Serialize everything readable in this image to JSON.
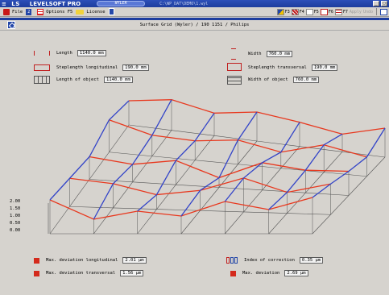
{
  "app": {
    "logo": "≡  LS",
    "name": "LEVELSOFT PRO",
    "badge": "WYLER",
    "path": "C:\\WP_DAT\\DEMO\\1.wyl"
  },
  "menu": {
    "file": "File",
    "file_num": "2",
    "options": "Options F5",
    "license": "License",
    "fkeys": [
      {
        "key": "F3"
      },
      {
        "key": "F4"
      },
      {
        "key": "F5"
      },
      {
        "key": "F6"
      },
      {
        "key": "F7"
      },
      {
        "key": "Apply",
        "disabled": true
      },
      {
        "key": "Undo",
        "disabled": true
      }
    ]
  },
  "document": {
    "title": "Surface Grid (Wyler) / 190 1151 / Philips"
  },
  "dimensions": {
    "length_label": "Length",
    "length_value": "1140.0 mm",
    "step_long_label": "Steplength longitudinal",
    "step_long_value": "190.0 mm",
    "length_obj_label": "Length of object",
    "length_obj_value": "1140.0 mm",
    "width_label": "Width",
    "width_value": "760.0 mm",
    "step_trans_label": "Steplength transversal",
    "step_trans_value": "190.0 mm",
    "width_obj_label": "Width of object",
    "width_obj_value": "760.0 mm"
  },
  "scale": {
    "labels": [
      "2.00",
      "1.50",
      "1.00",
      "0.50",
      "0.00"
    ]
  },
  "results": {
    "max_dev_long_label": "Max. deviation longitudinal",
    "max_dev_long_value": "2.01 µm",
    "max_dev_trans_label": "Max. deviation transversal",
    "max_dev_trans_value": "1.56 µm",
    "index_corr_label": "Index of correction",
    "index_corr_value": "0.35 µm",
    "max_dev_label": "Max. deviation",
    "max_dev_value": "2.69 µm"
  },
  "colors": {
    "longitudinal": "#3344c8",
    "transversal": "#e8381e",
    "base_grid": "#555555"
  }
}
